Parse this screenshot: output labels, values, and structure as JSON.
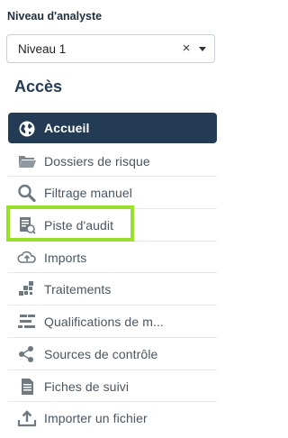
{
  "analyst_level": {
    "label": "Niveau d'analyste",
    "selected": "Niveau 1",
    "clear_symbol": "×"
  },
  "access": {
    "title": "Accès",
    "items": [
      {
        "label": "Accueil",
        "icon": "globe-icon",
        "active": true
      },
      {
        "label": "Dossiers de risque",
        "icon": "folder-icon"
      },
      {
        "label": "Filtrage manuel",
        "icon": "magnifier-icon"
      },
      {
        "label": "Piste d'audit",
        "icon": "audit-document-icon",
        "highlighted": true
      },
      {
        "label": "Imports",
        "icon": "cloud-upload-icon"
      },
      {
        "label": "Traitements",
        "icon": "processing-blocks-icon"
      },
      {
        "label": "Qualifications de m...",
        "icon": "qualifications-icon"
      },
      {
        "label": "Sources de contrôle",
        "icon": "share-nodes-icon"
      },
      {
        "label": "Fiches de suivi",
        "icon": "document-icon"
      },
      {
        "label": "Importer un fichier",
        "icon": "upload-tray-icon"
      }
    ]
  },
  "colors": {
    "active_background": "#243b55",
    "highlight_border": "#99e02a"
  }
}
